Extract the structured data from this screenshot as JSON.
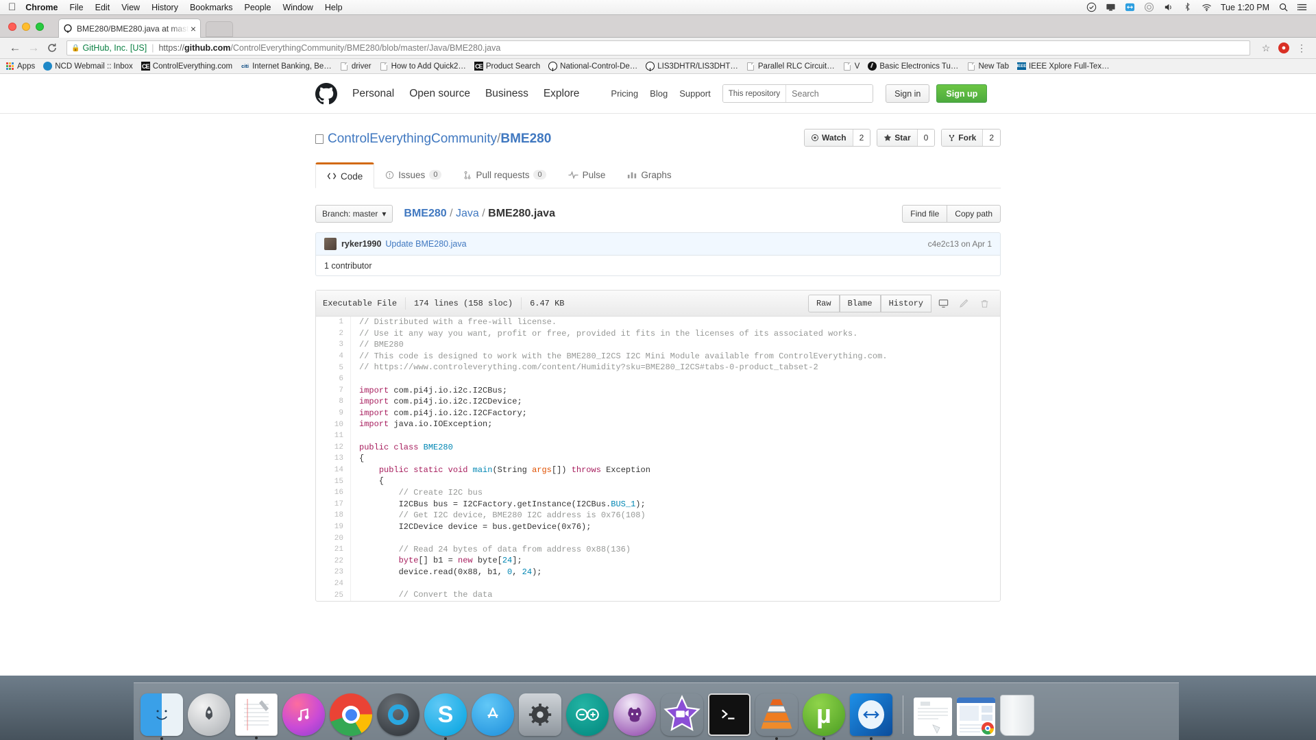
{
  "macbar": {
    "apple": "apple-logo",
    "menus": [
      "Chrome",
      "File",
      "Edit",
      "View",
      "History",
      "Bookmarks",
      "People",
      "Window",
      "Help"
    ],
    "clock": "Tue 1:20 PM",
    "status_icons": [
      "checkmark-icon",
      "display-icon",
      "teamviewer-icon",
      "creative-cloud-icon",
      "volume-icon",
      "bluetooth-icon",
      "wifi-icon"
    ],
    "search_icon": "spotlight-search-icon",
    "notification_icon": "notification-center-icon"
  },
  "browser": {
    "tab_title": "BME280/BME280.java at mast",
    "tab_favicon": "github-icon",
    "tab_close": "×",
    "back_icon": "←",
    "forward_icon": "→",
    "reload_icon": "C",
    "security_label": "GitHub, Inc. [US]",
    "url_scheme": "https://",
    "url_host": "github.com",
    "url_path": "/ControlEverythingCommunity/BME280/blob/master/Java/BME280.java",
    "star_icon": "☆",
    "extension_icon": "adblock-icon",
    "menu_icon": "⋮",
    "bookmarks": [
      {
        "label": "Apps",
        "icon": "apps-grid-icon"
      },
      {
        "label": "NCD Webmail :: Inbox",
        "icon": "webmail-icon"
      },
      {
        "label": "ControlEverything.com",
        "icon": "ce-icon"
      },
      {
        "label": "Internet Banking, Be…",
        "icon": "citi-icon"
      },
      {
        "label": "driver",
        "icon": "page-icon"
      },
      {
        "label": "How to Add Quick2…",
        "icon": "page-icon"
      },
      {
        "label": "Product Search",
        "icon": "ce-icon"
      },
      {
        "label": "National-Control-De…",
        "icon": "github-icon"
      },
      {
        "label": "LIS3DHTR/LIS3DHT…",
        "icon": "github-icon"
      },
      {
        "label": "Parallel RLC Circuit…",
        "icon": "page-icon"
      },
      {
        "label": "V",
        "icon": "page-icon"
      },
      {
        "label": "Basic Electronics Tu…",
        "icon": "basic-electronics-icon"
      },
      {
        "label": "New Tab",
        "icon": "page-icon"
      },
      {
        "label": "IEEE Xplore Full-Tex…",
        "icon": "ieee-icon"
      }
    ]
  },
  "github": {
    "logo": "octocat-logo",
    "nav_primary": [
      "Personal",
      "Open source",
      "Business",
      "Explore"
    ],
    "nav_secondary": [
      "Pricing",
      "Blog",
      "Support"
    ],
    "search_scope": "This repository",
    "search_placeholder": "Search",
    "sign_in": "Sign in",
    "sign_up": "Sign up",
    "repo": {
      "owner": "ControlEverythingCommunity",
      "separator": "/",
      "name": "BME280",
      "actions": [
        {
          "label": "Watch",
          "count": "2",
          "icon": "eye-icon"
        },
        {
          "label": "Star",
          "count": "0",
          "icon": "star-icon"
        },
        {
          "label": "Fork",
          "count": "2",
          "icon": "fork-icon"
        }
      ]
    },
    "tabs": [
      {
        "label": "Code",
        "icon": "code-icon",
        "count": "",
        "active": true
      },
      {
        "label": "Issues",
        "icon": "issue-icon",
        "count": "0",
        "active": false
      },
      {
        "label": "Pull requests",
        "icon": "pull-request-icon",
        "count": "0",
        "active": false
      },
      {
        "label": "Pulse",
        "icon": "pulse-icon",
        "count": "",
        "active": false
      },
      {
        "label": "Graphs",
        "icon": "graph-icon",
        "count": "",
        "active": false
      }
    ],
    "file_actions": {
      "branch_label": "Branch: master",
      "branch_caret": "▾",
      "breadcrumb": [
        "BME280",
        "Java",
        "BME280.java"
      ],
      "find_file": "Find file",
      "copy_path": "Copy path"
    },
    "commit": {
      "author": "ryker1990",
      "message": "Update BME280.java",
      "sha": "c4e2c13",
      "date": "on Apr 1",
      "contributors": "1 contributor"
    },
    "file_meta": {
      "mode": "Executable File",
      "lines": "174 lines (158 sloc)",
      "size": "6.47 KB",
      "raw": "Raw",
      "blame": "Blame",
      "history": "History",
      "icons": [
        "desktop-icon",
        "pencil-edit-icon",
        "trash-delete-icon"
      ]
    },
    "code_lines": [
      {
        "n": 1,
        "segs": [
          {
            "t": "// Distributed with a free-will license.",
            "c": "c-com"
          }
        ]
      },
      {
        "n": 2,
        "segs": [
          {
            "t": "// Use it any way you want, profit or free, provided it fits in the licenses of its associated works.",
            "c": "c-com"
          }
        ]
      },
      {
        "n": 3,
        "segs": [
          {
            "t": "// BME280",
            "c": "c-com"
          }
        ]
      },
      {
        "n": 4,
        "segs": [
          {
            "t": "// This code is designed to work with the BME280_I2CS I2C Mini Module available from ControlEverything.com.",
            "c": "c-com"
          }
        ]
      },
      {
        "n": 5,
        "segs": [
          {
            "t": "// https://www.controleverything.com/content/Humidity?sku=BME280_I2CS#tabs-0-product_tabset-2",
            "c": "c-com"
          }
        ]
      },
      {
        "n": 6,
        "segs": []
      },
      {
        "n": 7,
        "segs": [
          {
            "t": "import",
            "c": "c-kw"
          },
          {
            "t": " com.pi4j.io.i2c.I2CBus;",
            "c": ""
          }
        ]
      },
      {
        "n": 8,
        "segs": [
          {
            "t": "import",
            "c": "c-kw"
          },
          {
            "t": " com.pi4j.io.i2c.I2CDevice;",
            "c": ""
          }
        ]
      },
      {
        "n": 9,
        "segs": [
          {
            "t": "import",
            "c": "c-kw"
          },
          {
            "t": " com.pi4j.io.i2c.I2CFactory;",
            "c": ""
          }
        ]
      },
      {
        "n": 10,
        "segs": [
          {
            "t": "import",
            "c": "c-kw"
          },
          {
            "t": " java.io.IOException;",
            "c": ""
          }
        ]
      },
      {
        "n": 11,
        "segs": []
      },
      {
        "n": 12,
        "segs": [
          {
            "t": "public class",
            "c": "c-kw"
          },
          {
            "t": " ",
            "c": ""
          },
          {
            "t": "BME280",
            "c": "c-typ"
          }
        ]
      },
      {
        "n": 13,
        "segs": [
          {
            "t": "{",
            "c": ""
          }
        ]
      },
      {
        "n": 14,
        "segs": [
          {
            "t": "    ",
            "c": ""
          },
          {
            "t": "public static void",
            "c": "c-kw"
          },
          {
            "t": " ",
            "c": ""
          },
          {
            "t": "main",
            "c": "c-typ"
          },
          {
            "t": "(String ",
            "c": ""
          },
          {
            "t": "args",
            "c": "c-var"
          },
          {
            "t": "[]) ",
            "c": ""
          },
          {
            "t": "throws",
            "c": "c-kw"
          },
          {
            "t": " Exception",
            "c": ""
          }
        ]
      },
      {
        "n": 15,
        "segs": [
          {
            "t": "    {",
            "c": ""
          }
        ]
      },
      {
        "n": 16,
        "segs": [
          {
            "t": "        ",
            "c": ""
          },
          {
            "t": "// Create I2C bus",
            "c": "c-com"
          }
        ]
      },
      {
        "n": 17,
        "segs": [
          {
            "t": "        I2CBus bus = I2CFactory.getInstance(I2CBus.",
            "c": ""
          },
          {
            "t": "BUS_1",
            "c": "c-typ"
          },
          {
            "t": ");",
            "c": ""
          }
        ]
      },
      {
        "n": 18,
        "segs": [
          {
            "t": "        ",
            "c": ""
          },
          {
            "t": "// Get I2C device, BME280 I2C address is 0x76(108)",
            "c": "c-com"
          }
        ]
      },
      {
        "n": 19,
        "segs": [
          {
            "t": "        I2CDevice device = bus.getDevice(0x76);",
            "c": ""
          }
        ]
      },
      {
        "n": 20,
        "segs": []
      },
      {
        "n": 21,
        "segs": [
          {
            "t": "        ",
            "c": ""
          },
          {
            "t": "// Read 24 bytes of data from address 0x88(136)",
            "c": "c-com"
          }
        ]
      },
      {
        "n": 22,
        "segs": [
          {
            "t": "        ",
            "c": ""
          },
          {
            "t": "byte",
            "c": "c-kw"
          },
          {
            "t": "[] b1 = ",
            "c": ""
          },
          {
            "t": "new",
            "c": "c-kw"
          },
          {
            "t": " byte[",
            "c": ""
          },
          {
            "t": "24",
            "c": "c-num"
          },
          {
            "t": "];",
            "c": ""
          }
        ]
      },
      {
        "n": 23,
        "segs": [
          {
            "t": "        device.read(0x88, b1, ",
            "c": ""
          },
          {
            "t": "0",
            "c": "c-num"
          },
          {
            "t": ", ",
            "c": ""
          },
          {
            "t": "24",
            "c": "c-num"
          },
          {
            "t": ");",
            "c": ""
          }
        ]
      },
      {
        "n": 24,
        "segs": []
      },
      {
        "n": 25,
        "segs": [
          {
            "t": "        ",
            "c": ""
          },
          {
            "t": "// Convert the data",
            "c": "c-com"
          }
        ]
      }
    ]
  },
  "dock": {
    "apps": [
      {
        "name": "finder",
        "running": true
      },
      {
        "name": "launchpad",
        "running": false
      },
      {
        "name": "notes",
        "running": true
      },
      {
        "name": "itunes",
        "running": false
      },
      {
        "name": "chrome",
        "running": true
      },
      {
        "name": "quicktime",
        "running": false
      },
      {
        "name": "skype",
        "running": true
      },
      {
        "name": "app-store",
        "running": false
      },
      {
        "name": "system-preferences",
        "running": false
      },
      {
        "name": "arduino",
        "running": false
      },
      {
        "name": "github-desktop",
        "running": false
      },
      {
        "name": "imovie",
        "running": false
      },
      {
        "name": "terminal",
        "running": false
      },
      {
        "name": "vlc",
        "running": true
      },
      {
        "name": "utorrent",
        "running": true
      },
      {
        "name": "teamviewer",
        "running": true
      }
    ],
    "minimized": [
      "document-window",
      "browser-window"
    ],
    "trash": "trash-bin"
  }
}
